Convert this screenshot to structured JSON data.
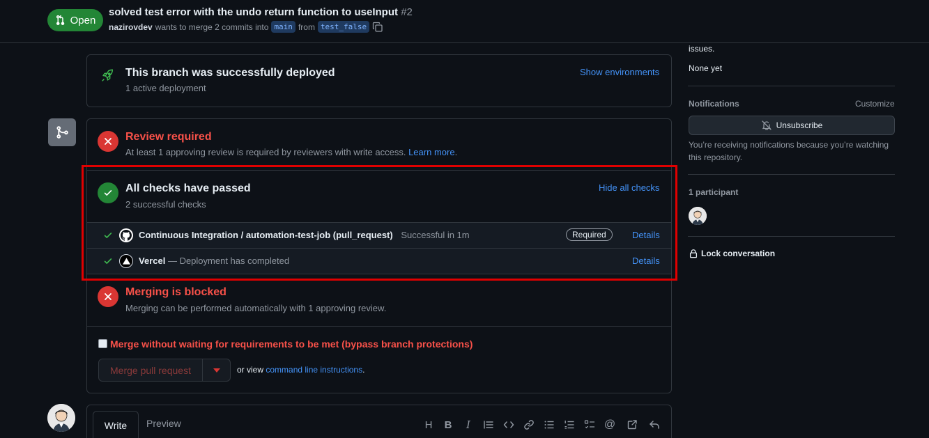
{
  "header": {
    "state": "Open",
    "title": "solved test error with the undo return function to useInput",
    "number": "#2",
    "author": "nazirovdev",
    "merge_text": "wants to merge 2 commits into",
    "base_branch": "main",
    "from_text": "from",
    "head_branch": "test_false"
  },
  "deployment": {
    "title": "This branch was successfully deployed",
    "subtitle": "1 active deployment",
    "action": "Show environments"
  },
  "review": {
    "title": "Review required",
    "description": "At least 1 approving review is required by reviewers with write access.",
    "learn_more": "Learn more",
    "period": "."
  },
  "checks": {
    "title": "All checks have passed",
    "subtitle": "2 successful checks",
    "toggle": "Hide all checks",
    "items": [
      {
        "name": "Continuous Integration / automation-test-job (pull_request)",
        "status": "Successful in 1m",
        "badge": "Required",
        "action": "Details"
      },
      {
        "name": "Vercel",
        "status": "— Deployment has completed",
        "action": "Details"
      }
    ]
  },
  "merge_block": {
    "title": "Merging is blocked",
    "description": "Merging can be performed automatically with 1 approving review.",
    "bypass_label": "Merge without waiting for requirements to be met (bypass branch protections)",
    "merge_button": "Merge pull request",
    "or_view": "or view",
    "cli_link": "command line instructions",
    "period": "."
  },
  "comment": {
    "tab_write": "Write",
    "tab_preview": "Preview"
  },
  "sidebar": {
    "issues_tail": "issues.",
    "milestone_value": "None yet",
    "notifications_heading": "Notifications",
    "customize": "Customize",
    "unsubscribe": "Unsubscribe",
    "notification_reason": "You’re receiving notifications because you’re watching this repository.",
    "participants_heading": "1 participant",
    "lock": "Lock conversation"
  },
  "colors": {
    "accent_green": "#238636",
    "danger": "#f85149",
    "link": "#4493f8",
    "highlight": "#e00000"
  }
}
